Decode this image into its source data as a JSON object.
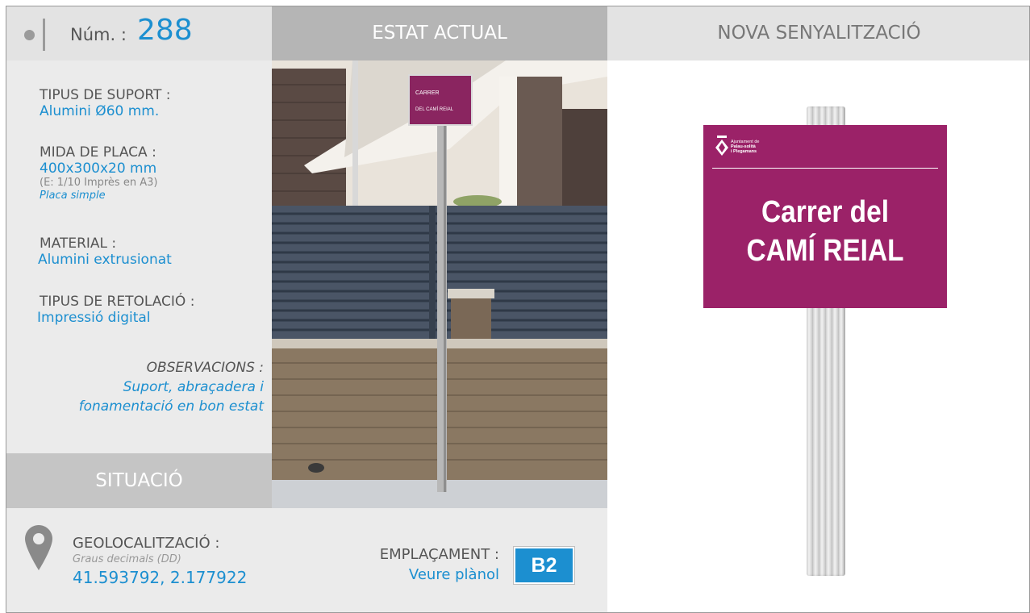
{
  "header": {
    "num_label": "Núm. :",
    "num_value": "288",
    "estat_actual": "ESTAT ACTUAL",
    "nova_senyalitzacio": "NOVA SENYALITZACIÓ"
  },
  "specs": {
    "tipus_suport_label": "TIPUS DE SUPORT :",
    "tipus_suport_value": "Alumini Ø60 mm.",
    "mida_placa_label": "MIDA DE PLACA :",
    "mida_placa_value": "400x300x20 mm",
    "mida_placa_scale": "(E: 1/10 Imprès en A3)",
    "mida_placa_type": "Placa simple",
    "material_label": "MATERIAL :",
    "material_value": "Alumini extrusionat",
    "retolacio_label": "TIPUS DE RETOLACIÓ :",
    "retolacio_value": "Impressió digital",
    "observacions_label": "OBSERVACIONS :",
    "observacions_line1": "Suport, abraçadera i",
    "observacions_line2": "fonamentació en bon estat"
  },
  "situacio": {
    "title": "SITUACIÓ",
    "geo_label": "GEOLOCALITZACIÓ :",
    "geo_sub": "Graus decimals (DD)",
    "geo_value": "41.593792, 2.177922",
    "emplacament_label": "EMPLAÇAMENT :",
    "emplacament_link": "Veure plànol",
    "emplacament_code": "B2"
  },
  "photo_sign": {
    "line1": "CARRER",
    "line2": "DEL CAMÍ REIAL"
  },
  "new_sign": {
    "logo_line1": "Ajuntament de",
    "logo_line2": "Palau-solità",
    "logo_line3": "i Plegamans",
    "line1": "Carrer del",
    "line2": "CAMÍ REIAL"
  },
  "colors": {
    "accent_blue": "#1c8fd0",
    "plate_magenta": "#9b2268",
    "header_grey": "#b5b5b5"
  },
  "icons": {
    "location": "map-pin-icon",
    "bullet": "dot-icon"
  }
}
